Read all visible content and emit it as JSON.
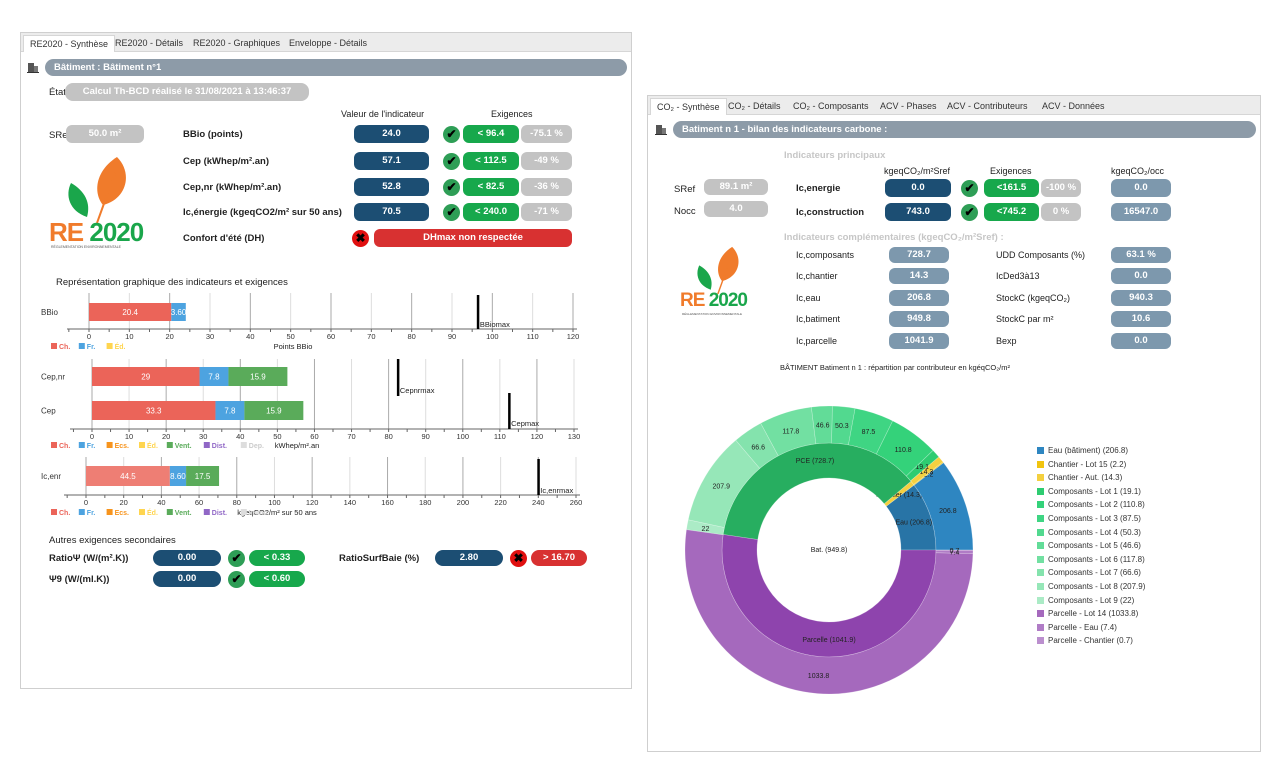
{
  "left": {
    "tabs": [
      "RE2020 - Synthèse",
      "RE2020 - Détails",
      "RE2020 - Graphiques",
      "Enveloppe - Détails"
    ],
    "header": "Bâtiment : Bâtiment n°1",
    "etat_label": "État",
    "etat_value": "Calcul Th-BCD réalisé le 31/08/2021 à 13:46:37",
    "col_value": "Valeur de l'indicateur",
    "col_req": "Exigences",
    "sref_label": "SRef",
    "sref_value": "50.0 m²",
    "logo": {
      "text1": "RE",
      "text2": "2020",
      "subtitle": "RÉGLEMENTATION ENVIRONNEMENTALE"
    },
    "rows": [
      {
        "label": "BBio (points)",
        "value": "24.0",
        "status": "ok",
        "req": "< 96.4",
        "gap": "-75.1 %"
      },
      {
        "label": "Cep (kWhep/m².an)",
        "value": "57.1",
        "status": "ok",
        "req": "< 112.5",
        "gap": "-49 %"
      },
      {
        "label": "Cep,nr (kWhep/m².an)",
        "value": "52.8",
        "status": "ok",
        "req": "< 82.5",
        "gap": "-36 %"
      },
      {
        "label": "Ic,énergie (kgeqCO2/m² sur 50 ans)",
        "value": "70.5",
        "status": "ok",
        "req": "< 240.0",
        "gap": "-71 %"
      }
    ],
    "confort": {
      "label": "Confort d'été (DH)",
      "status": "ko",
      "message": "DHmax non respectée"
    },
    "graph_title": "Représentation graphique des indicateurs et exigences",
    "secondary_title": "Autres exigences secondaires",
    "secondary": [
      {
        "label": "RatioΨ (W/(m².K))",
        "value": "0.00",
        "status": "ok",
        "req": "< 0.33"
      },
      {
        "label": "Ψ9 (W/(ml.K))",
        "value": "0.00",
        "status": "ok",
        "req": "< 0.60"
      },
      {
        "label": "RatioSurfBaie (%)",
        "value": "2.80",
        "status": "ko",
        "req": "> 16.70"
      }
    ]
  },
  "right": {
    "tabs": [
      "CO₂ - Synthèse",
      "CO₂ - Détails",
      "CO₂ - Composants",
      "ACV - Phases",
      "ACV - Contributeurs",
      "ACV - Données"
    ],
    "header": "Batiment n 1 - bilan des indicateurs carbone :",
    "main_title": "Indicateurs principaux",
    "col_unit": "kgeqCO₂/m²Sref",
    "col_req": "Exigences",
    "col_occ": "kgeqCO₂/occ",
    "sref_label": "SRef",
    "sref_value": "89.1 m²",
    "nocc_label": "Nocc",
    "nocc_value": "4.0",
    "main_rows": [
      {
        "label": "Ic,energie",
        "value": "0.0",
        "status": "ok",
        "req": "<161.5",
        "gap": "-100 %",
        "occ": "0.0"
      },
      {
        "label": "Ic,construction",
        "value": "743.0",
        "status": "ok",
        "req": "<745.2",
        "gap": "0 %",
        "occ": "16547.0"
      }
    ],
    "comp_title": "Indicateurs complémentaires (kgeqCO₂/m²Sref) :",
    "comp_left": [
      {
        "label": "Ic,composants",
        "value": "728.7"
      },
      {
        "label": "Ic,chantier",
        "value": "14.3"
      },
      {
        "label": "Ic,eau",
        "value": "206.8"
      },
      {
        "label": "Ic,batiment",
        "value": "949.8"
      },
      {
        "label": "Ic,parcelle",
        "value": "1041.9"
      }
    ],
    "comp_right": [
      {
        "label": "UDD Composants (%)",
        "value": "63.1 %"
      },
      {
        "label": "IcDed3à13",
        "value": "0.0"
      },
      {
        "label": "StockC (kgeqCO₂)",
        "value": "940.3"
      },
      {
        "label": "StockC par m²",
        "value": "10.6"
      },
      {
        "label": "Bexp",
        "value": "0.0"
      }
    ],
    "logo": {
      "text1": "RE",
      "text2": "2020",
      "subtitle": "RÉGLEMENTATION ENVIRONNEMENTALE"
    },
    "chart_title": "BÂTIMENT Batiment n 1 : répartition par contributeur en kgéqCO₂/m²"
  },
  "colors": {
    "ch": "#eb6459",
    "fr": "#4da3e0",
    "ecs": "#f7941d",
    "ed": "#ffd54f",
    "vent": "#5aab5a",
    "dist": "#9067c6",
    "dep": "#dddddd",
    "ok": "#17a84c",
    "ko": "#d83131",
    "value": "#1c4e73"
  },
  "chart_data": [
    {
      "type": "bar",
      "orientation": "horizontal",
      "stacked": true,
      "xlabel": "Points BBio",
      "xlim": [
        0,
        120
      ],
      "ticks": [
        0,
        10,
        20,
        30,
        40,
        50,
        60,
        70,
        80,
        90,
        100,
        110,
        120
      ],
      "legend": [
        "Ch.",
        "Fr.",
        "Éd."
      ],
      "bars": [
        {
          "category": "BBio",
          "segments": [
            {
              "s": "Ch.",
              "v": 20.4,
              "label": "20.4"
            },
            {
              "s": "Fr.",
              "v": 3.6,
              "label": "3.60"
            }
          ]
        }
      ],
      "thresholds": [
        {
          "label": "BBiomax",
          "value": 96.4
        }
      ]
    },
    {
      "type": "bar",
      "orientation": "horizontal",
      "stacked": true,
      "xlabel": "kWhep/m².an",
      "xlim": [
        0,
        130
      ],
      "ticks": [
        0,
        10,
        20,
        30,
        40,
        50,
        60,
        70,
        80,
        90,
        100,
        110,
        120,
        130
      ],
      "legend": [
        "Ch.",
        "Fr.",
        "Ecs.",
        "Éd.",
        "Vent.",
        "Dist.",
        "Dep."
      ],
      "bars": [
        {
          "category": "Cep,nr",
          "segments": [
            {
              "s": "Ch.",
              "v": 29,
              "label": "29"
            },
            {
              "s": "Fr.",
              "v": 7.8,
              "label": "7.8"
            },
            {
              "s": "Ecs.",
              "v": 0,
              "label": "0"
            },
            {
              "s": "Vent.",
              "v": 15.9,
              "label": "15.9"
            },
            {
              "s": "Dist.",
              "v": 0,
              "label": "0"
            }
          ]
        },
        {
          "category": "Cep",
          "segments": [
            {
              "s": "Ch.",
              "v": 33.3,
              "label": "33.3"
            },
            {
              "s": "Fr.",
              "v": 7.8,
              "label": "7.8"
            },
            {
              "s": "Ecs.",
              "v": 0,
              "label": "0"
            },
            {
              "s": "Vent.",
              "v": 15.9,
              "label": "15.9"
            },
            {
              "s": "Dist.",
              "v": 0,
              "label": "0"
            }
          ]
        }
      ],
      "thresholds": [
        {
          "label": "Cepnrmax",
          "value": 82.5,
          "bar": 0
        },
        {
          "label": "Cepmax",
          "value": 112.5,
          "bar": 1
        }
      ]
    },
    {
      "type": "bar",
      "orientation": "horizontal",
      "stacked": true,
      "xlabel": "kgeqCO2/m² sur 50 ans",
      "xlim": [
        0,
        260
      ],
      "ticks": [
        0,
        20,
        40,
        60,
        80,
        100,
        120,
        140,
        160,
        180,
        200,
        220,
        240,
        260
      ],
      "legend": [
        "Ch.",
        "Fr.",
        "Ecs.",
        "Éd.",
        "Vent.",
        "Dist.",
        "Immo."
      ],
      "bars": [
        {
          "category": "Ic,enr",
          "segments": [
            {
              "s": "Ch.",
              "v": 44.5,
              "label": "44.5"
            },
            {
              "s": "Fr.",
              "v": 8.6,
              "label": "8.60"
            },
            {
              "s": "Vent.",
              "v": 17.5,
              "label": "17.5"
            },
            {
              "s": "Dist.",
              "v": 0,
              "label": "0"
            }
          ]
        }
      ],
      "thresholds": [
        {
          "label": "Ic,enrmax",
          "value": 240
        }
      ]
    },
    {
      "type": "sunburst",
      "title": "BÂTIMENT Batiment n 1 : répartition par contributeur en kgéqCO₂/m²",
      "center": "Bat. (949.8)",
      "inner": [
        {
          "label": "Eau (206.8)",
          "value": 206.8,
          "color": "#2874a6"
        },
        {
          "label": "Chantier (14.3)",
          "value": 14.3,
          "color": "#f4d03f"
        },
        {
          "label": "PCE (728.7)",
          "value": 728.7,
          "color": "#27ae60"
        },
        {
          "label": "Parcelle (1041.9)",
          "value": 1041.9,
          "color": "#8e44ad"
        }
      ],
      "outer": [
        {
          "name": "Eau (bâtiment)",
          "value": 206.8,
          "label": "206.8",
          "color": "#2e86c1"
        },
        {
          "name": "Chantier - Lot 15",
          "value": 2.2,
          "label": "2.2",
          "color": "#f1c40f"
        },
        {
          "name": "Chantier - Aut.",
          "value": 14.3,
          "label": "14.3",
          "color": "#f4d03f"
        },
        {
          "name": "Composants - Lot 1",
          "value": 19.1,
          "label": "19.1",
          "color": "#2ecc71"
        },
        {
          "name": "Composants - Lot 2",
          "value": 110.8,
          "label": "110.8",
          "color": "#34d27a"
        },
        {
          "name": "Composants - Lot 3",
          "value": 87.5,
          "label": "87.5",
          "color": "#3fd583"
        },
        {
          "name": "Composants - Lot 4",
          "value": 50.3,
          "label": "50.3",
          "color": "#52d98f"
        },
        {
          "name": "Composants - Lot 5",
          "value": 46.6,
          "label": "46.6",
          "color": "#62dc98"
        },
        {
          "name": "Composants - Lot 6",
          "value": 117.8,
          "label": "117.8",
          "color": "#72e0a2"
        },
        {
          "name": "Composants - Lot 7",
          "value": 66.6,
          "label": "66.6",
          "color": "#84e3ad"
        },
        {
          "name": "Composants - Lot 8",
          "value": 207.9,
          "label": "207.9",
          "color": "#96e7b8"
        },
        {
          "name": "Composants - Lot 9",
          "value": 22,
          "label": "22",
          "color": "#abebc6"
        },
        {
          "name": "Parcelle - Lot 14",
          "value": 1033.8,
          "label": "1033.8",
          "color": "#a569bd"
        },
        {
          "name": "Parcelle - Eau",
          "value": 7.4,
          "label": "7.4",
          "color": "#b07cc6"
        },
        {
          "name": "Parcelle - Chantier",
          "value": 0.7,
          "label": "0.7",
          "color": "#bb8fce"
        }
      ],
      "legend": [
        "Eau (bâtiment) (206.8)",
        "Chantier - Lot 15 (2.2)",
        "Chantier - Aut. (14.3)",
        "Composants - Lot 1 (19.1)",
        "Composants - Lot 2 (110.8)",
        "Composants - Lot 3 (87.5)",
        "Composants - Lot 4 (50.3)",
        "Composants - Lot 5 (46.6)",
        "Composants - Lot 6 (117.8)",
        "Composants - Lot 7 (66.6)",
        "Composants - Lot 8 (207.9)",
        "Composants - Lot 9 (22)",
        "Parcelle - Lot 14 (1033.8)",
        "Parcelle - Eau (7.4)",
        "Parcelle - Chantier (0.7)"
      ]
    }
  ]
}
